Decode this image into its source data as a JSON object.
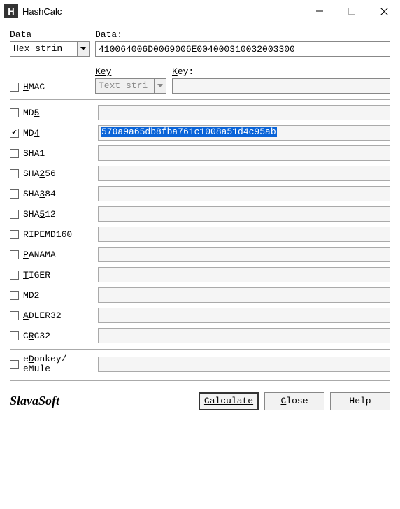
{
  "window": {
    "title": "HashCalc",
    "icon_letter": "H"
  },
  "data_section": {
    "format_label": "Data",
    "format_value": "Hex strin",
    "data_label": "Data:",
    "data_value": "410064006D0069006E004000310032003300"
  },
  "hmac_section": {
    "hmac_label": "HMAC",
    "hmac_checked": false,
    "key_format_label": "Key",
    "key_format_value": "Text stri",
    "key_label": "Key:",
    "key_value": ""
  },
  "hashes": [
    {
      "name": "MD5",
      "label_html": "MD<span class='underline'>5</span>",
      "checked": false,
      "value": ""
    },
    {
      "name": "MD4",
      "label_html": "MD<span class='underline'>4</span>",
      "checked": true,
      "value": "570a9a65db8fba761c1008a51d4c95ab",
      "selected": true
    },
    {
      "name": "SHA1",
      "label_html": "SHA<span class='underline'>1</span>",
      "checked": false,
      "value": ""
    },
    {
      "name": "SHA256",
      "label_html": "SHA<span class='underline'>2</span>56",
      "checked": false,
      "value": ""
    },
    {
      "name": "SHA384",
      "label_html": "SHA<span class='underline'>3</span>84",
      "checked": false,
      "value": ""
    },
    {
      "name": "SHA512",
      "label_html": "SHA<span class='underline'>5</span>12",
      "checked": false,
      "value": ""
    },
    {
      "name": "RIPEMD160",
      "label_html": "<span class='underline'>R</span>IPEMD160",
      "checked": false,
      "value": ""
    },
    {
      "name": "PANAMA",
      "label_html": "<span class='underline'>P</span>ANAMA",
      "checked": false,
      "value": ""
    },
    {
      "name": "TIGER",
      "label_html": "<span class='underline'>T</span>IGER",
      "checked": false,
      "value": ""
    },
    {
      "name": "MD2",
      "label_html": "M<span class='underline'>D</span>2",
      "checked": false,
      "value": ""
    },
    {
      "name": "ADLER32",
      "label_html": "<span class='underline'>A</span>DLER32",
      "checked": false,
      "value": ""
    },
    {
      "name": "CRC32",
      "label_html": "C<span class='underline'>R</span>C32",
      "checked": false,
      "value": ""
    }
  ],
  "edonkey": {
    "label_html": "e<span class='underline'>D</span>onkey/<br>eMule",
    "checked": false,
    "value": ""
  },
  "brand": "SlavaSoft",
  "buttons": {
    "calculate": "Calculate",
    "close": "Close",
    "help": "Help"
  }
}
